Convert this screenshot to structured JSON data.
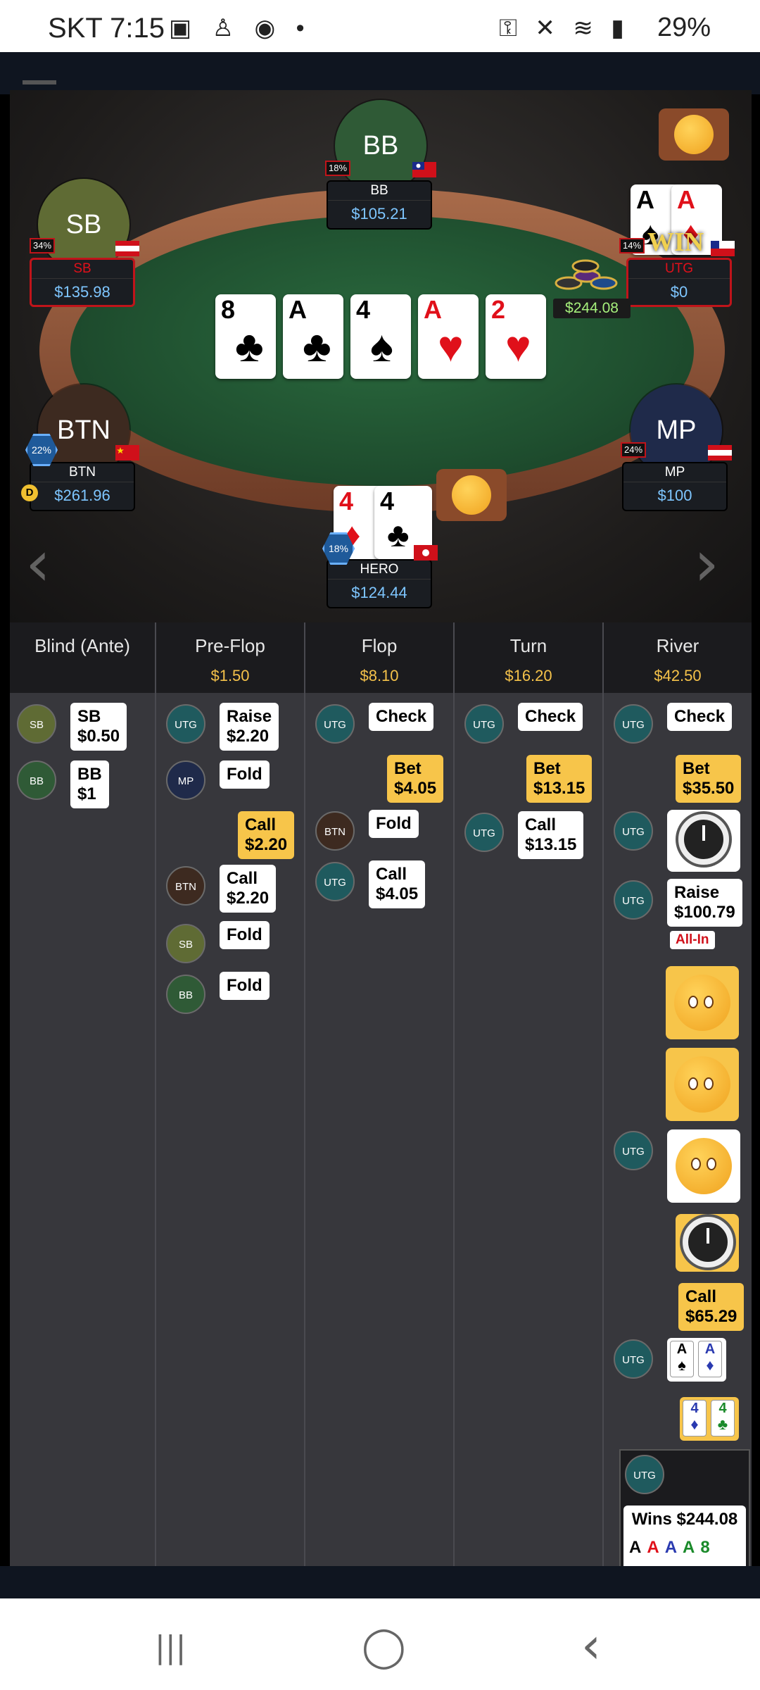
{
  "status_bar": {
    "carrier_time": "SKT 7:15",
    "left_icons": "▣ ♙ ◉ •",
    "right_icons": "⚿ ✕ ≋ ▮",
    "battery": "29%"
  },
  "table": {
    "seats": {
      "bb": {
        "avatar": "BB",
        "name": "BB",
        "stack": "$105.21",
        "percent": "18%"
      },
      "sb": {
        "avatar": "SB",
        "name": "SB",
        "stack": "$135.98",
        "percent": "34%"
      },
      "utg": {
        "name": "UTG",
        "stack": "$0",
        "percent": "14%",
        "win_label": "WIN"
      },
      "btn": {
        "avatar": "BTN",
        "name": "BTN",
        "stack": "$261.96",
        "percent": "22%"
      },
      "mp": {
        "avatar": "MP",
        "name": "MP",
        "stack": "$100",
        "percent": "24%"
      },
      "hero": {
        "name": "HERO",
        "stack": "$124.44",
        "percent": "18%"
      }
    },
    "board": [
      {
        "rank": "8",
        "suit": "♣",
        "color": "#000000"
      },
      {
        "rank": "A",
        "suit": "♣",
        "color": "#000000"
      },
      {
        "rank": "4",
        "suit": "♠",
        "color": "#000000"
      },
      {
        "rank": "A",
        "suit": "♥",
        "color": "#e0101a"
      },
      {
        "rank": "2",
        "suit": "♥",
        "color": "#e0101a"
      }
    ],
    "pot": "$244.08",
    "utg_cards": [
      {
        "rank": "A",
        "suit": "♠"
      },
      {
        "rank": "A",
        "suit": "♦"
      }
    ],
    "hero_cards": [
      {
        "rank": "4",
        "suit": "♦"
      },
      {
        "rank": "4",
        "suit": "♣"
      }
    ],
    "dealer_button": "D"
  },
  "history": {
    "columns": [
      {
        "name": "Blind (Ante)",
        "amount": ""
      },
      {
        "name": "Pre-Flop",
        "amount": "$1.50"
      },
      {
        "name": "Flop",
        "amount": "$8.10"
      },
      {
        "name": "Turn",
        "amount": "$16.20"
      },
      {
        "name": "River",
        "amount": "$42.50"
      }
    ],
    "blind": [
      {
        "pos": "SB",
        "action": "SB",
        "amount": "$0.50"
      },
      {
        "pos": "BB",
        "action": "BB",
        "amount": "$1"
      }
    ],
    "preflop": [
      {
        "pos": "UTG",
        "action": "Raise",
        "amount": "$2.20"
      },
      {
        "pos": "MP",
        "action": "Fold"
      },
      {
        "action": "Call",
        "amount": "$2.20"
      },
      {
        "pos": "BTN",
        "action": "Call",
        "amount": "$2.20"
      },
      {
        "pos": "SB",
        "action": "Fold"
      },
      {
        "pos": "BB",
        "action": "Fold"
      }
    ],
    "flop": [
      {
        "pos": "UTG",
        "action": "Check"
      },
      {
        "action": "Bet",
        "amount": "$4.05"
      },
      {
        "pos": "BTN",
        "action": "Fold"
      },
      {
        "pos": "UTG",
        "action": "Call",
        "amount": "$4.05"
      }
    ],
    "turn": [
      {
        "pos": "UTG",
        "action": "Check"
      },
      {
        "action": "Bet",
        "amount": "$13.15"
      },
      {
        "pos": "UTG",
        "action": "Call",
        "amount": "$13.15"
      }
    ],
    "river": [
      {
        "pos": "UTG",
        "action": "Check"
      },
      {
        "action": "Bet",
        "amount": "$35.50"
      },
      {
        "pos": "UTG",
        "icon": "alarm-clock"
      },
      {
        "pos": "UTG",
        "action": "Raise",
        "amount": "$100.79",
        "tag": "All-In"
      },
      {
        "icon": "facepalm-emoji"
      },
      {
        "icon": "facepalm-emoji"
      },
      {
        "pos": "UTG",
        "icon": "thinking-emoji"
      },
      {
        "icon": "alarm-clock"
      },
      {
        "action": "Call",
        "amount": "$65.29"
      },
      {
        "pos": "UTG",
        "cards": [
          {
            "rank": "A",
            "suit": "♠"
          },
          {
            "rank": "A",
            "suit": "♦"
          }
        ]
      },
      {
        "cards": [
          {
            "rank": "4",
            "suit": "♦"
          },
          {
            "rank": "4",
            "suit": "♣"
          }
        ]
      },
      {
        "pos": "UTG",
        "result": "Wins $244.08"
      }
    ]
  },
  "colors": {
    "felt": "#2a6a3e",
    "rail": "#a86b4a",
    "bet_bubble": "#f7c54a",
    "stack_text": "#7ec6ff",
    "pot_text": "#a6f07c",
    "street_amount": "#f5c24a"
  },
  "navbar": {
    "recents": "|||",
    "home": "◯",
    "back": "‹"
  }
}
